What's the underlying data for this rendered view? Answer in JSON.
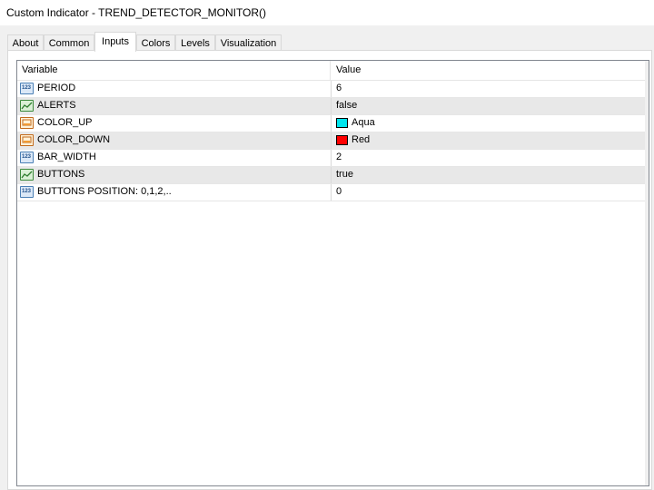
{
  "window": {
    "title": "Custom Indicator - TREND_DETECTOR_MONITOR()"
  },
  "tabs": [
    {
      "label": "About"
    },
    {
      "label": "Common"
    },
    {
      "label": "Inputs",
      "active": true
    },
    {
      "label": "Colors"
    },
    {
      "label": "Levels"
    },
    {
      "label": "Visualization"
    }
  ],
  "table": {
    "headers": {
      "variable": "Variable",
      "value": "Value"
    },
    "rows": [
      {
        "icon": "numeric-icon",
        "name": "PERIOD",
        "value": "6"
      },
      {
        "icon": "boolean-icon",
        "name": "ALERTS",
        "value": "false"
      },
      {
        "icon": "color-icon",
        "name": "COLOR_UP",
        "value": "Aqua",
        "swatch": "#00e5ee"
      },
      {
        "icon": "color-icon",
        "name": "COLOR_DOWN",
        "value": "Red",
        "swatch": "#ff0000"
      },
      {
        "icon": "numeric-icon",
        "name": "BAR_WIDTH",
        "value": "2"
      },
      {
        "icon": "boolean-icon",
        "name": "BUTTONS",
        "value": "true"
      },
      {
        "icon": "numeric-icon",
        "name": "BUTTONS POSITION: 0,1,2,..",
        "value": "0"
      }
    ]
  },
  "colors": {
    "alt_row": "#e8e8e8",
    "grid_border": "#828790"
  }
}
